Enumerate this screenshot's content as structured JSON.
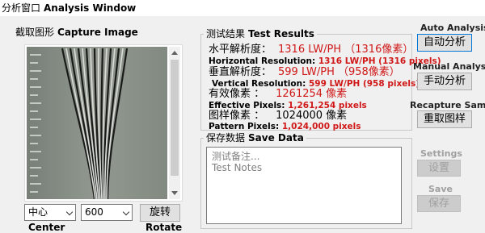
{
  "window": {
    "title_cn": "分析窗口",
    "title_en": "Analysis Window"
  },
  "capture": {
    "caption_cn": "截取图形",
    "caption_en": "Capture Image",
    "position_value": "中心",
    "position_label": "Center",
    "zoom_value": "600",
    "rotate_label_cn": "旋转",
    "rotate_label_en": "Rotate"
  },
  "results": {
    "caption_cn": "测试结果",
    "caption_en": "Test Results",
    "horizontal_cn_label": "水平解析度：",
    "horizontal_cn_value": "1316 LW/PH （1316像素）",
    "horizontal_en_label": "Horizontal Resolution:",
    "horizontal_en_value": "1316 LW/PH (1316 pixels)",
    "vertical_cn_label": "垂直解析度：",
    "vertical_cn_value": "599 LW/PH （958像素）",
    "vertical_en_label": "Vertical Resolution:",
    "vertical_en_value": "599 LW/PH (958 pixels)",
    "effective_cn_label": "有效像素 ：",
    "effective_cn_value": "1261254 像素",
    "effective_en_label": "Effective Pixels:",
    "effective_en_value": "1,261,254 pixels",
    "pattern_cn_label": "图样像素 ：",
    "pattern_cn_value": "1024000 像素",
    "pattern_en_label": "Pattern Pixels:",
    "pattern_en_value": "1,024,000 pixels"
  },
  "save_data": {
    "caption_cn": "保存数据",
    "caption_en": "Save Data",
    "notes_placeholder_cn": "测试备注...",
    "notes_placeholder_en": "Test Notes"
  },
  "actions": {
    "auto_label": "Auto Analysis",
    "auto_button": "自动分析",
    "manual_label": "Manual Analysis",
    "manual_button": "手动分析",
    "recapture_label": "Recapture Sample",
    "recapture_button": "重取图样",
    "settings_label": "Settings",
    "settings_button": "设置",
    "save_label": "Save",
    "save_button": "保存"
  },
  "colors": {
    "result_value": "#d01818",
    "focus_border": "#0078d7",
    "disabled_text": "#a0a0a0"
  }
}
